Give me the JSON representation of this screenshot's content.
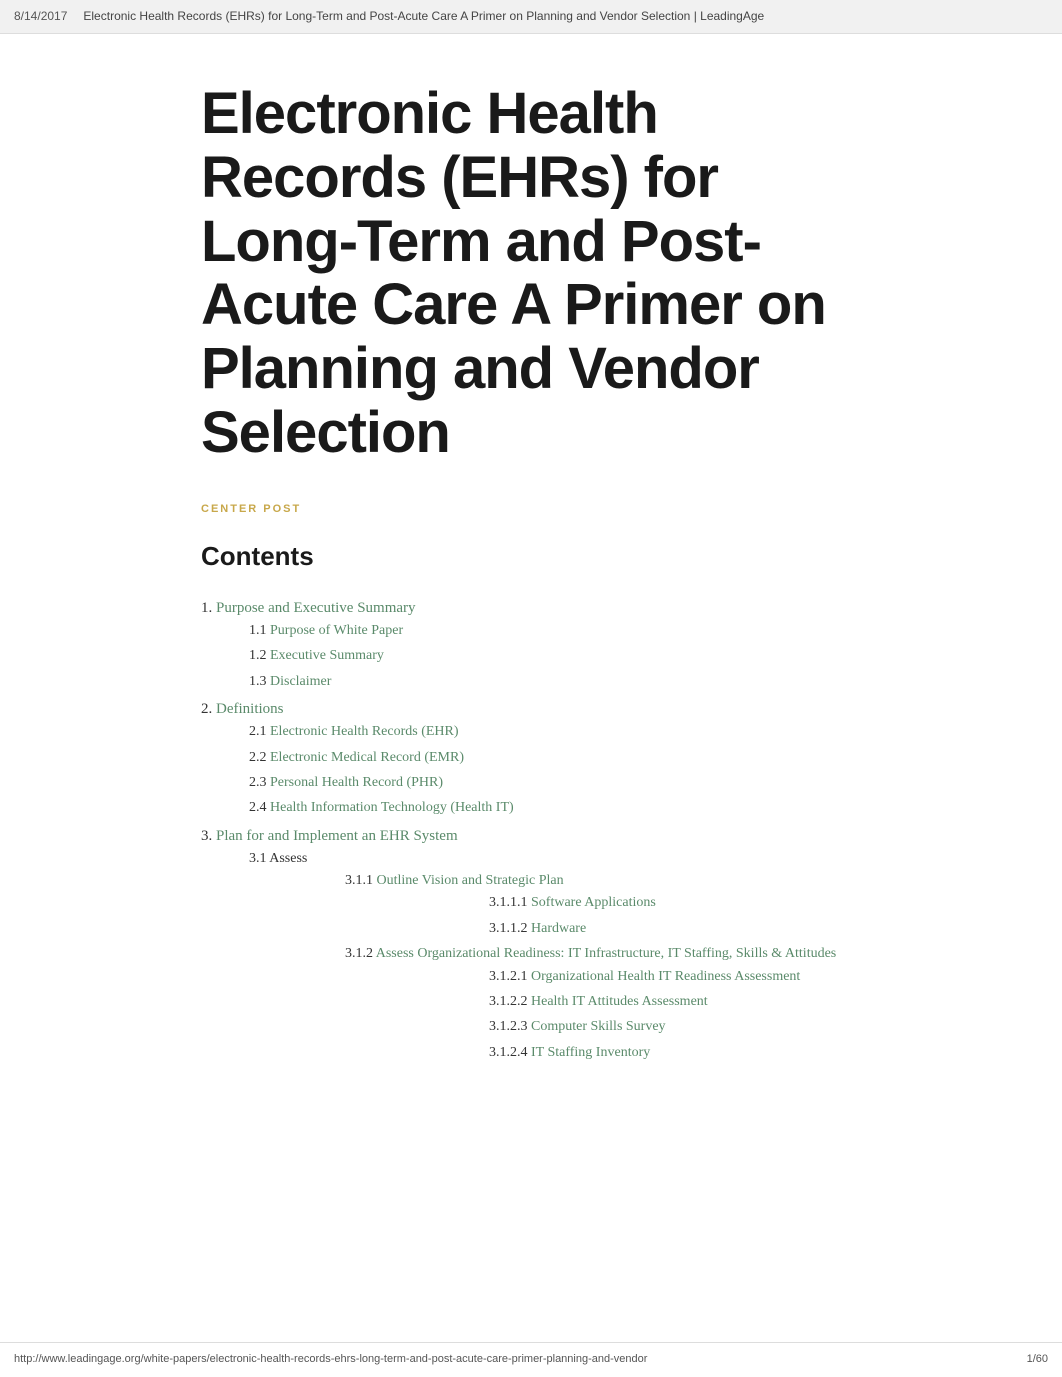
{
  "browser": {
    "date": "8/14/2017",
    "title": "Electronic Health Records (EHRs) for Long-Term and Post-Acute Care A Primer on Planning and Vendor Selection | LeadingAge"
  },
  "page": {
    "main_title": "Electronic Health Records (EHRs) for Long-Term and Post-Acute Care A Primer on Planning and Vendor Selection",
    "category_label": "CENTER POST",
    "contents_heading": "Contents"
  },
  "toc": [
    {
      "number": "1.",
      "label": "Purpose and Executive Summary",
      "link": true,
      "children": [
        {
          "number": "1.1",
          "label": "Purpose of White Paper",
          "link": true
        },
        {
          "number": "1.2",
          "label": "Executive Summary",
          "link": true
        },
        {
          "number": "1.3",
          "label": "Disclaimer",
          "link": true
        }
      ]
    },
    {
      "number": "2.",
      "label": "Definitions",
      "link": true,
      "children": [
        {
          "number": "2.1",
          "label": "Electronic Health Records (EHR)",
          "link": true
        },
        {
          "number": "2.2",
          "label": "Electronic Medical Record (EMR)",
          "link": true
        },
        {
          "number": "2.3",
          "label": "Personal Health Record (PHR)",
          "link": true
        },
        {
          "number": "2.4",
          "label": "Health Information Technology (Health IT)",
          "link": true
        }
      ]
    },
    {
      "number": "3.",
      "label": "Plan for and Implement an EHR System",
      "link": true,
      "children": [
        {
          "number": "3.1",
          "label": "Assess",
          "link": false,
          "children": [
            {
              "number": "3.1.1",
              "label": "Outline Vision and Strategic Plan",
              "link": true,
              "children": [
                {
                  "number": "3.1.1.1",
                  "label": "Software Applications",
                  "link": true
                },
                {
                  "number": "3.1.1.2",
                  "label": "Hardware",
                  "link": true
                }
              ]
            },
            {
              "number": "3.1.2",
              "label": "Assess Organizational Readiness: IT Infrastructure, IT Staffing, Skills & Attitudes",
              "link": true,
              "children": [
                {
                  "number": "3.1.2.1",
                  "label": "Organizational Health IT Readiness Assessment",
                  "link": true
                },
                {
                  "number": "3.1.2.2",
                  "label": "Health IT Attitudes Assessment",
                  "link": true
                },
                {
                  "number": "3.1.2.3",
                  "label": "Computer Skills Survey",
                  "link": true
                },
                {
                  "number": "3.1.2.4",
                  "label": "IT Staffing Inventory",
                  "link": true
                }
              ]
            }
          ]
        }
      ]
    }
  ],
  "footer": {
    "url": "http://www.leadingage.org/white-papers/electronic-health-records-ehrs-long-term-and-post-acute-care-primer-planning-and-vendor",
    "page": "1/60"
  }
}
